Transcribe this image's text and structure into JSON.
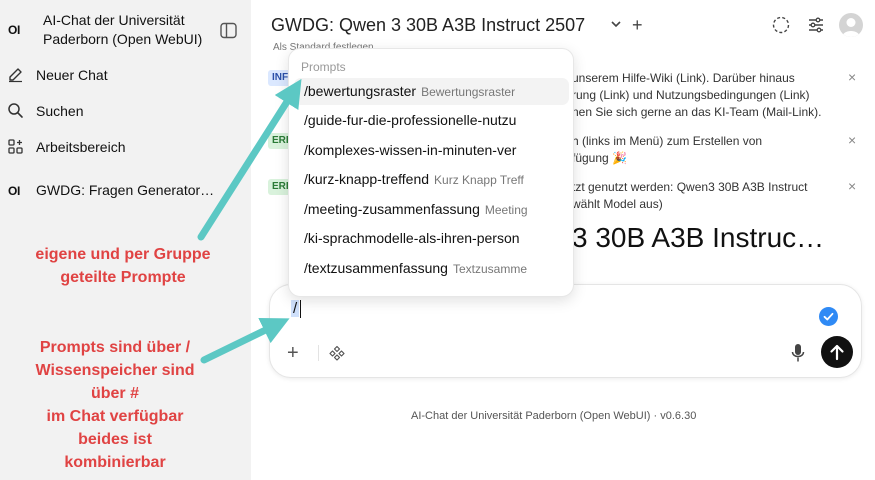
{
  "app": {
    "logo_text": "OI",
    "name": "AI-Chat der Universität Paderborn (Open WebUI)"
  },
  "sidebar": {
    "items": [
      {
        "label": "Neuer Chat",
        "icon": "edit-icon"
      },
      {
        "label": "Suchen",
        "icon": "search-icon"
      },
      {
        "label": "Arbeitsbereich",
        "icon": "workspace-icon"
      }
    ],
    "chats": [
      {
        "label": "GWDG: Fragen Generator…",
        "icon_text": "OI"
      }
    ]
  },
  "annotations": {
    "first": "eigene und per Gruppe geteilte Prompte",
    "second_lines": [
      "Prompts sind über /",
      "Wissenspeicher sind",
      "über #",
      "im Chat verfügbar",
      "beides ist",
      "kombinierbar"
    ]
  },
  "header": {
    "model": "GWDG: Qwen 3 30B A3B Instruct 2507",
    "set_default": "Als Standard festlegen"
  },
  "banners": [
    {
      "type": "INFO",
      "lines": [
        "unserem Hilfe-Wiki (Link). Darüber hinaus",
        "rung (Link) und Nutzungsbedingungen (Link)",
        "nen Sie sich gerne an das KI-Team (Mail-Link)."
      ]
    },
    {
      "type": "EREIGNIS",
      "lines": [
        "h (links im Menü) zum Erstellen von",
        "fügung 🎉"
      ]
    },
    {
      "type": "EREIGNIS",
      "lines": [
        "tzt genutzt werden: Qwen3 30B A3B Instruct",
        "wählt Model aus)"
      ]
    }
  ],
  "main_title_fragment": "3 30B A3B Instruc…",
  "prompts_menu": {
    "header": "Prompts",
    "items": [
      {
        "command": "/bewertungsraster",
        "title": "Bewertungsraster"
      },
      {
        "command": "/guide-fur-die-professionelle-nutzu",
        "title": ""
      },
      {
        "command": "/komplexes-wissen-in-minuten-ver",
        "title": ""
      },
      {
        "command": "/kurz-knapp-treffend",
        "title": "Kurz Knapp Treff"
      },
      {
        "command": "/meeting-zusammenfassung",
        "title": "Meeting"
      },
      {
        "command": "/ki-sprachmodelle-als-ihren-person",
        "title": ""
      },
      {
        "command": "/textzusammenfassung",
        "title": "Textzusamme"
      }
    ]
  },
  "chat_input": {
    "value": "/"
  },
  "footer": "AI-Chat der Universität Paderborn (Open WebUI) · v0.6.30",
  "colors": {
    "annotation_red": "#e04343",
    "arrow_teal": "#5cc8c4",
    "send_button": "#111111",
    "check_blue": "#2f8af5"
  }
}
